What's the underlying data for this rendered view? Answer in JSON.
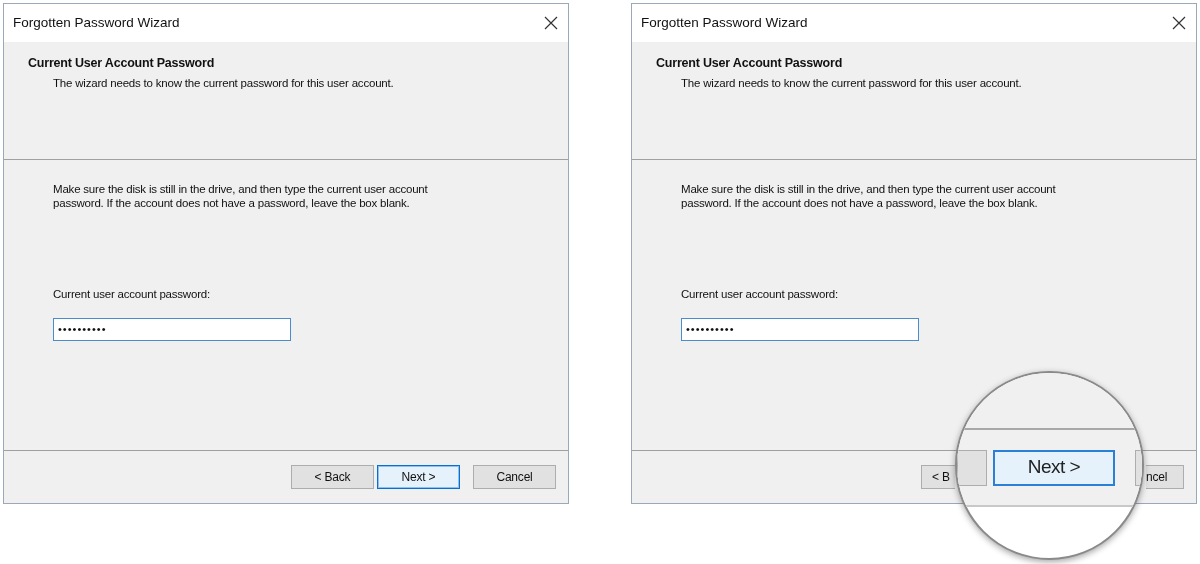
{
  "windows": [
    {
      "title": "Forgotten Password Wizard",
      "heading": "Current User Account Password",
      "subheading": "The wizard needs to know the current password for this user account.",
      "instructions": "Make sure the disk is still in the drive, and then type the current user account password. If the account does not have a password, leave the box blank.",
      "field_label": "Current user account password:",
      "password": "••••••••••",
      "buttons": [
        {
          "label": "< Back",
          "focused": false,
          "kind": "full"
        },
        {
          "label": "Next >",
          "focused": true,
          "kind": "full"
        },
        {
          "label": "Cancel",
          "focused": false,
          "kind": "full"
        }
      ]
    },
    {
      "title": "Forgotten Password Wizard",
      "heading": "Current User Account Password",
      "subheading": "The wizard needs to know the current password for this user account.",
      "instructions": "Make sure the disk is still in the drive, and then type the current user account password. If the account does not have a password, leave the box blank.",
      "field_label": "Current user account password:",
      "password": "••••••••••",
      "buttons": [
        {
          "label": "< B",
          "kind": "left-part"
        },
        {
          "label": "ncel",
          "kind": "right-part"
        }
      ],
      "magnifier": {
        "button": {
          "label": "Next >",
          "focused": true
        }
      }
    }
  ]
}
